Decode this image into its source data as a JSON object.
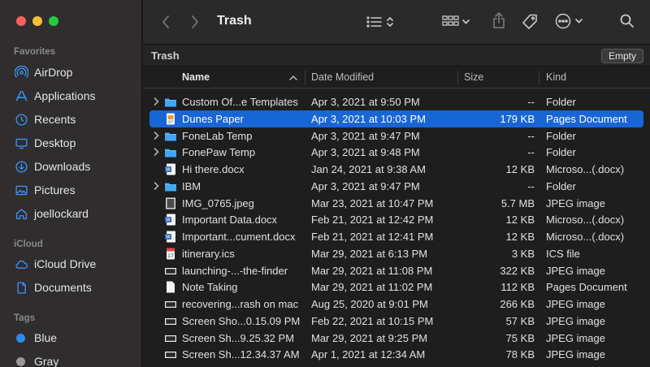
{
  "window": {
    "title": "Trash"
  },
  "sidebar": {
    "sections": [
      {
        "key": "favorites",
        "label": "Favorites"
      },
      {
        "key": "icloud",
        "label": "iCloud"
      },
      {
        "key": "tags",
        "label": "Tags"
      }
    ],
    "favorites": [
      {
        "label": "AirDrop",
        "icon": "airdrop-icon"
      },
      {
        "label": "Applications",
        "icon": "applications-icon"
      },
      {
        "label": "Recents",
        "icon": "recents-icon"
      },
      {
        "label": "Desktop",
        "icon": "desktop-icon"
      },
      {
        "label": "Downloads",
        "icon": "downloads-icon"
      },
      {
        "label": "Pictures",
        "icon": "pictures-icon"
      },
      {
        "label": "joellockard",
        "icon": "home-icon"
      }
    ],
    "icloud": [
      {
        "label": "iCloud Drive",
        "icon": "cloud-icon"
      },
      {
        "label": "Documents",
        "icon": "document-icon"
      }
    ],
    "tags": [
      {
        "label": "Blue",
        "color": "#2d8cf0"
      },
      {
        "label": "Gray",
        "color": "#9a9a9a"
      }
    ]
  },
  "pathbar": {
    "title": "Trash",
    "empty_label": "Empty"
  },
  "columns": {
    "name": "Name",
    "date": "Date Modified",
    "size": "Size",
    "kind": "Kind"
  },
  "files": [
    {
      "name": "Custom Of...e Templates",
      "date": "Apr 3, 2021 at 9:50 PM",
      "size": "--",
      "kind": "Folder",
      "type": "folder",
      "expandable": true
    },
    {
      "name": "Dunes Paper",
      "date": "Apr 3, 2021 at 10:03 PM",
      "size": "179 KB",
      "kind": "Pages Document",
      "type": "pages",
      "selected": true
    },
    {
      "name": "FoneLab Temp",
      "date": "Apr 3, 2021 at 9:47 PM",
      "size": "--",
      "kind": "Folder",
      "type": "folder",
      "expandable": true
    },
    {
      "name": "FonePaw Temp",
      "date": "Apr 3, 2021 at 9:48 PM",
      "size": "--",
      "kind": "Folder",
      "type": "folder",
      "expandable": true
    },
    {
      "name": "Hi there.docx",
      "date": "Jan 24, 2021 at 9:38 AM",
      "size": "12 KB",
      "kind": "Microso...(.docx)",
      "type": "docx"
    },
    {
      "name": "IBM",
      "date": "Apr 3, 2021 at 9:47 PM",
      "size": "--",
      "kind": "Folder",
      "type": "folder",
      "expandable": true
    },
    {
      "name": "IMG_0765.jpeg",
      "date": "Mar 23, 2021 at 10:47 PM",
      "size": "5.7 MB",
      "kind": "JPEG image",
      "type": "photo"
    },
    {
      "name": "Important Data.docx",
      "date": "Feb 21, 2021 at 12:42 PM",
      "size": "12 KB",
      "kind": "Microso...(.docx)",
      "type": "docx"
    },
    {
      "name": "Important...cument.docx",
      "date": "Feb 21, 2021 at 12:41 PM",
      "size": "12 KB",
      "kind": "Microso...(.docx)",
      "type": "docx"
    },
    {
      "name": "itinerary.ics",
      "date": "Mar 29, 2021 at 6:13 PM",
      "size": "3 KB",
      "kind": "ICS file",
      "type": "ics"
    },
    {
      "name": "launching-...-the-finder",
      "date": "Mar 29, 2021 at 11:08 PM",
      "size": "322 KB",
      "kind": "JPEG image",
      "type": "screenshot"
    },
    {
      "name": "Note Taking",
      "date": "Mar 29, 2021 at 11:02 PM",
      "size": "112 KB",
      "kind": "Pages Document",
      "type": "blank"
    },
    {
      "name": "recovering...rash on mac",
      "date": "Aug 25, 2020 at 9:01 PM",
      "size": "266 KB",
      "kind": "JPEG image",
      "type": "screenshot"
    },
    {
      "name": "Screen Sho...0.15.09 PM",
      "date": "Feb 22, 2021 at 10:15 PM",
      "size": "57 KB",
      "kind": "JPEG image",
      "type": "screenshot"
    },
    {
      "name": "Screen Sh...9.25.32 PM",
      "date": "Mar 29, 2021 at 9:25 PM",
      "size": "75 KB",
      "kind": "JPEG image",
      "type": "screenshot"
    },
    {
      "name": "Screen Sh...12.34.37 AM",
      "date": "Apr 1, 2021 at 12:34 AM",
      "size": "78 KB",
      "kind": "JPEG image",
      "type": "screenshot"
    }
  ],
  "colors": {
    "accent": "#1865d6",
    "folder": "#3fa6f6",
    "sidebar_icon": "#3d92f5"
  }
}
